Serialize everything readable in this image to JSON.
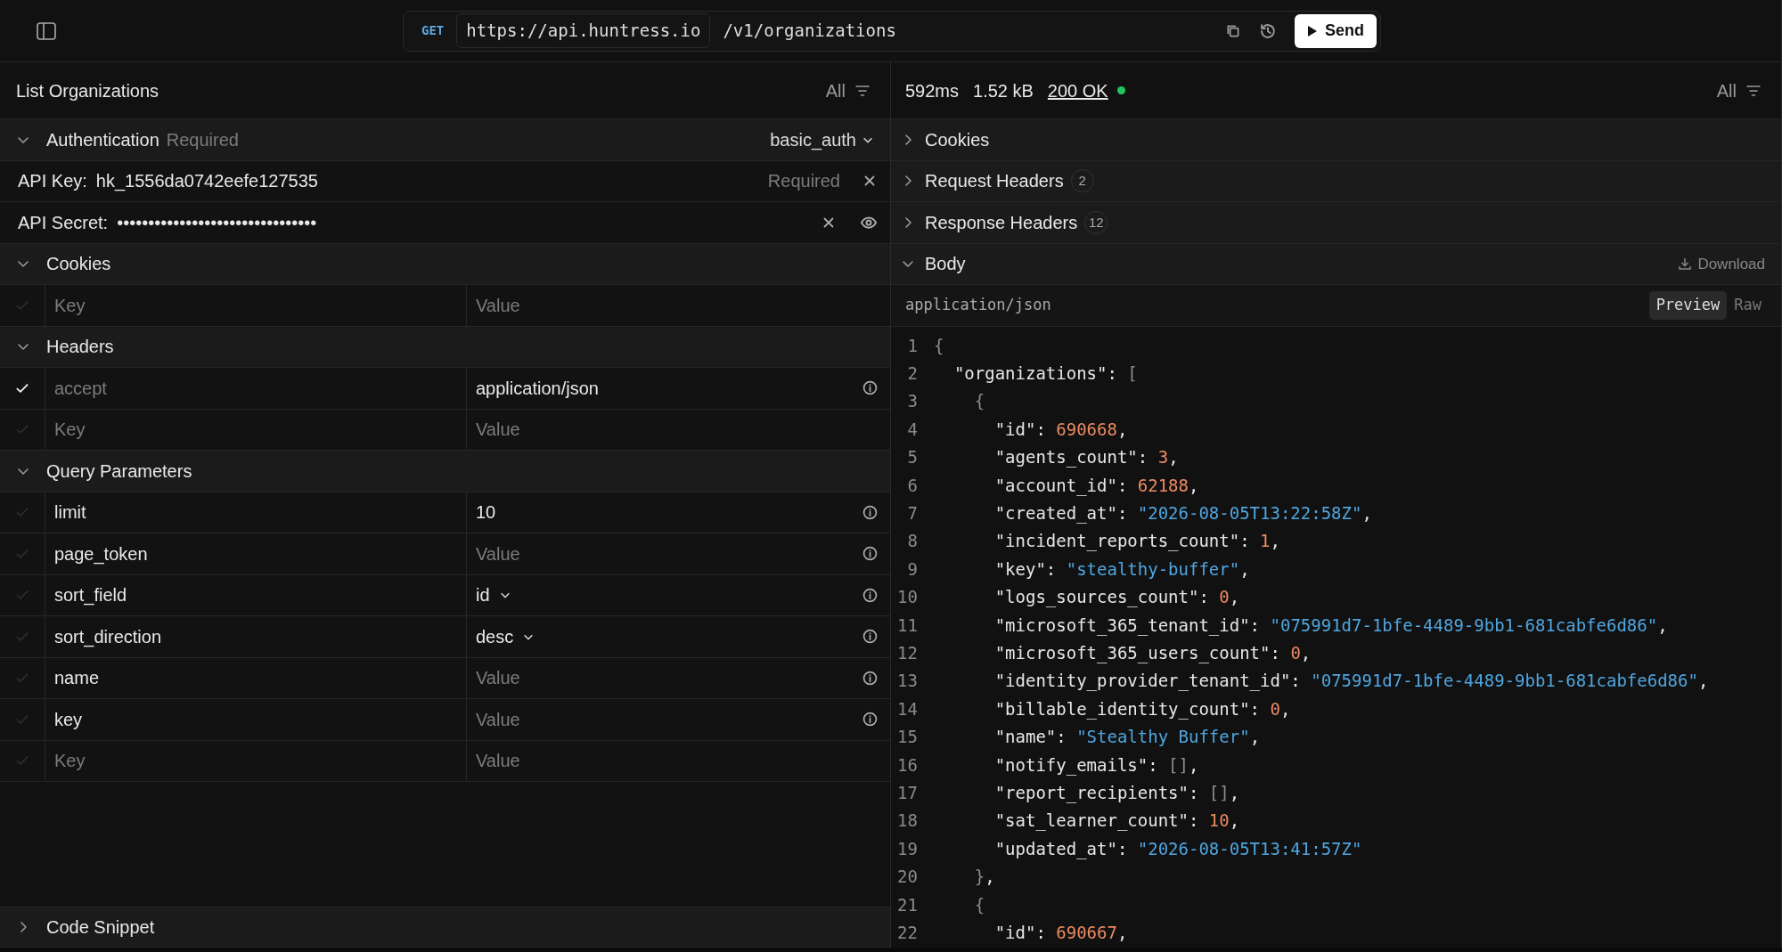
{
  "topbar": {
    "method": "GET",
    "base_url": "https://api.huntress.io",
    "path": "/v1/organizations",
    "send": "Send"
  },
  "request": {
    "title": "List Organizations",
    "filter": "All",
    "sections": [
      {
        "kind": "auth",
        "title": "Authentication",
        "note": "Required",
        "scheme": "basic_auth",
        "expanded": true,
        "fields": [
          {
            "label": "API Key:",
            "value": "hk_1556da0742eefe127535",
            "note": "Required",
            "masked": false
          },
          {
            "label": "API Secret:",
            "value": "••••••••••••••••••••••••••••••••",
            "masked": true
          }
        ]
      },
      {
        "kind": "params",
        "title": "Cookies",
        "expanded": true,
        "rows": [
          {
            "checked": false,
            "key_placeholder": "Key",
            "value_placeholder": "Value",
            "info": false
          }
        ]
      },
      {
        "kind": "params",
        "title": "Headers",
        "expanded": true,
        "rows": [
          {
            "checked": true,
            "key": "accept",
            "value": "application/json",
            "info": true
          },
          {
            "checked": false,
            "key_placeholder": "Key",
            "value_placeholder": "Value",
            "info": false
          }
        ]
      },
      {
        "kind": "params",
        "title": "Query Parameters",
        "expanded": true,
        "rows": [
          {
            "checked": false,
            "key": "limit",
            "value": "10",
            "info": true
          },
          {
            "checked": false,
            "key": "page_token",
            "value_placeholder": "Value",
            "info": true
          },
          {
            "checked": false,
            "key": "sort_field",
            "value": "id",
            "select": true,
            "info": true
          },
          {
            "checked": false,
            "key": "sort_direction",
            "value": "desc",
            "select": true,
            "info": true
          },
          {
            "checked": false,
            "key": "name",
            "value_placeholder": "Value",
            "info": true
          },
          {
            "checked": false,
            "key": "key",
            "value_placeholder": "Value",
            "info": true
          },
          {
            "checked": false,
            "key_placeholder": "Key",
            "value_placeholder": "Value",
            "info": false
          }
        ]
      }
    ],
    "footer": {
      "title": "Code Snippet",
      "expanded": false
    }
  },
  "response": {
    "time": "592ms",
    "size": "1.52 kB",
    "status": "200 OK",
    "filter": "All",
    "sections": [
      {
        "title": "Cookies",
        "expanded": false
      },
      {
        "title": "Request Headers",
        "count": "2",
        "expanded": false
      },
      {
        "title": "Response Headers",
        "count": "12",
        "expanded": false
      },
      {
        "title": "Body",
        "expanded": true,
        "action": "Download"
      }
    ],
    "body": {
      "content_type": "application/json",
      "views": [
        {
          "label": "Preview",
          "selected": true
        },
        {
          "label": "Raw",
          "selected": false
        }
      ],
      "lines": [
        {
          "n": "1",
          "tokens": [
            {
              "kind": "bracket",
              "text": "{"
            }
          ]
        },
        {
          "n": "2",
          "tokens": [
            {
              "kind": "plain",
              "text": "  \"organizations\": "
            },
            {
              "kind": "bracket",
              "text": "["
            }
          ]
        },
        {
          "n": "3",
          "tokens": [
            {
              "kind": "bracket",
              "text": "    {"
            }
          ]
        },
        {
          "n": "4",
          "tokens": [
            {
              "kind": "plain",
              "text": "      \"id\": "
            },
            {
              "kind": "number",
              "text": "690668"
            },
            {
              "kind": "plain",
              "text": ","
            }
          ]
        },
        {
          "n": "5",
          "tokens": [
            {
              "kind": "plain",
              "text": "      \"agents_count\": "
            },
            {
              "kind": "number",
              "text": "3"
            },
            {
              "kind": "plain",
              "text": ","
            }
          ]
        },
        {
          "n": "6",
          "tokens": [
            {
              "kind": "plain",
              "text": "      \"account_id\": "
            },
            {
              "kind": "number",
              "text": "62188"
            },
            {
              "kind": "plain",
              "text": ","
            }
          ]
        },
        {
          "n": "7",
          "tokens": [
            {
              "kind": "plain",
              "text": "      \"created_at\": "
            },
            {
              "kind": "string",
              "text": "\"2026-08-05T13:22:58Z\""
            },
            {
              "kind": "plain",
              "text": ","
            }
          ]
        },
        {
          "n": "8",
          "tokens": [
            {
              "kind": "plain",
              "text": "      \"incident_reports_count\": "
            },
            {
              "kind": "number",
              "text": "1"
            },
            {
              "kind": "plain",
              "text": ","
            }
          ]
        },
        {
          "n": "9",
          "tokens": [
            {
              "kind": "plain",
              "text": "      \"key\": "
            },
            {
              "kind": "string",
              "text": "\"stealthy-buffer\""
            },
            {
              "kind": "plain",
              "text": ","
            }
          ]
        },
        {
          "n": "10",
          "tokens": [
            {
              "kind": "plain",
              "text": "      \"logs_sources_count\": "
            },
            {
              "kind": "number",
              "text": "0"
            },
            {
              "kind": "plain",
              "text": ","
            }
          ]
        },
        {
          "n": "11",
          "tokens": [
            {
              "kind": "plain",
              "text": "      \"microsoft_365_tenant_id\": "
            },
            {
              "kind": "string",
              "text": "\"075991d7-1bfe-4489-9bb1-681cabfe6d86\""
            },
            {
              "kind": "plain",
              "text": ","
            }
          ]
        },
        {
          "n": "12",
          "tokens": [
            {
              "kind": "plain",
              "text": "      \"microsoft_365_users_count\": "
            },
            {
              "kind": "number",
              "text": "0"
            },
            {
              "kind": "plain",
              "text": ","
            }
          ]
        },
        {
          "n": "13",
          "tokens": [
            {
              "kind": "plain",
              "text": "      \"identity_provider_tenant_id\": "
            },
            {
              "kind": "string",
              "text": "\"075991d7-1bfe-4489-9bb1-681cabfe6d86\""
            },
            {
              "kind": "plain",
              "text": ","
            }
          ]
        },
        {
          "n": "14",
          "tokens": [
            {
              "kind": "plain",
              "text": "      \"billable_identity_count\": "
            },
            {
              "kind": "number",
              "text": "0"
            },
            {
              "kind": "plain",
              "text": ","
            }
          ]
        },
        {
          "n": "15",
          "tokens": [
            {
              "kind": "plain",
              "text": "      \"name\": "
            },
            {
              "kind": "string",
              "text": "\"Stealthy Buffer\""
            },
            {
              "kind": "plain",
              "text": ","
            }
          ]
        },
        {
          "n": "16",
          "tokens": [
            {
              "kind": "plain",
              "text": "      \"notify_emails\": "
            },
            {
              "kind": "bracket",
              "text": "[]"
            },
            {
              "kind": "plain",
              "text": ","
            }
          ]
        },
        {
          "n": "17",
          "tokens": [
            {
              "kind": "plain",
              "text": "      \"report_recipients\": "
            },
            {
              "kind": "bracket",
              "text": "[]"
            },
            {
              "kind": "plain",
              "text": ","
            }
          ]
        },
        {
          "n": "18",
          "tokens": [
            {
              "kind": "plain",
              "text": "      \"sat_learner_count\": "
            },
            {
              "kind": "number",
              "text": "10"
            },
            {
              "kind": "plain",
              "text": ","
            }
          ]
        },
        {
          "n": "19",
          "tokens": [
            {
              "kind": "plain",
              "text": "      \"updated_at\": "
            },
            {
              "kind": "string",
              "text": "\"2026-08-05T13:41:57Z\""
            }
          ]
        },
        {
          "n": "20",
          "tokens": [
            {
              "kind": "bracket",
              "text": "    }"
            },
            {
              "kind": "plain",
              "text": ","
            }
          ]
        },
        {
          "n": "21",
          "tokens": [
            {
              "kind": "bracket",
              "text": "    {"
            }
          ]
        },
        {
          "n": "22",
          "tokens": [
            {
              "kind": "plain",
              "text": "      \"id\": "
            },
            {
              "kind": "number",
              "text": "690667"
            },
            {
              "kind": "plain",
              "text": ","
            }
          ]
        }
      ]
    }
  }
}
